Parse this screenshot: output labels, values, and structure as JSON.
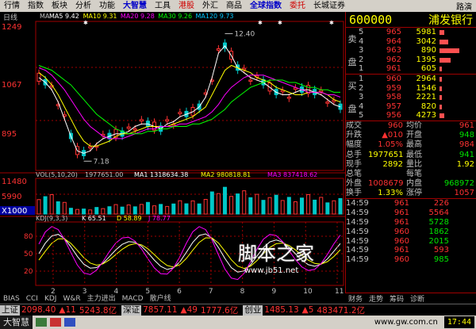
{
  "menu": {
    "items": [
      {
        "label": "行情",
        "style": "normal"
      },
      {
        "label": "指数",
        "style": "normal"
      },
      {
        "label": "板块",
        "style": "normal"
      },
      {
        "label": "分析",
        "style": "normal"
      },
      {
        "label": "功能",
        "style": "normal"
      },
      {
        "label": "大智慧",
        "style": "blue"
      },
      {
        "label": "工具",
        "style": "normal"
      },
      {
        "label": "港股",
        "style": "red"
      },
      {
        "label": "外汇",
        "style": "normal"
      },
      {
        "label": "商品",
        "style": "normal"
      },
      {
        "label": "全球指数",
        "style": "blue"
      },
      {
        "label": "委托",
        "style": "red"
      },
      {
        "label": "长城证券",
        "style": "normal"
      }
    ],
    "right_label": "路演"
  },
  "chart_header": {
    "period": "日线",
    "ma_label": "MA",
    "ma": [
      {
        "label": "MA5",
        "value": "9.42",
        "color": "#ffffff"
      },
      {
        "label": "MA10",
        "value": "9.31",
        "color": "#ffff00"
      },
      {
        "label": "MA20",
        "value": "9.28",
        "color": "#ff00ff"
      },
      {
        "label": "MA30",
        "value": "9.26",
        "color": "#00ff00"
      },
      {
        "label": "MA120",
        "value": "9.73",
        "color": "#00c8ff"
      }
    ]
  },
  "price_axis": [
    "1249",
    "1067",
    "895"
  ],
  "annotations": {
    "high": "12.40",
    "low": "7.18"
  },
  "volume_header": {
    "label": "VOL(5,10,20)",
    "value": "1977651.00",
    "ma1": "MA1 1318634.38",
    "ma2": "MA2 980818.81",
    "ma3": "MA3 837418.62"
  },
  "volume_axis": [
    "11480",
    "5990",
    "X1000"
  ],
  "kdj_header": {
    "label": "KDJ(9,3,3)",
    "k": "K 65.51",
    "d": "D 58.89",
    "j": "J 78.77"
  },
  "kdj_axis": [
    "80",
    "50",
    "20"
  ],
  "month_labels": [
    "2",
    "3",
    "4",
    "5",
    "6",
    "7",
    "8",
    "9",
    "10",
    "11"
  ],
  "indicator_tabs": [
    "BIAS",
    "CCI",
    "KDJ",
    "W&R",
    "主力进出",
    "MACD",
    "散户线"
  ],
  "chart_data": {
    "type": "candlestick",
    "series": [
      {
        "name": "MA5",
        "color": "#ffffff",
        "y": [
          10.6,
          10.4,
          10.1,
          9.6,
          8.9,
          8.2,
          7.6,
          7.5,
          7.6,
          7.9,
          8.1,
          8.2,
          8.3,
          8.3,
          8.4,
          8.6,
          8.7,
          8.7,
          8.6,
          8.5,
          8.7,
          8.8,
          9.0,
          9.1,
          9.2,
          9.4,
          9.8,
          10.6,
          11.6,
          11.9,
          11.5,
          11.0,
          10.8,
          10.6,
          10.5,
          10.4,
          10.2,
          10.0,
          9.9,
          9.9,
          10.0,
          10.1,
          10.1,
          10.0,
          9.9,
          9.7,
          9.5,
          9.4
        ]
      },
      {
        "name": "MA10",
        "color": "#ffff00",
        "y": [
          10.8,
          10.6,
          10.3,
          9.9,
          9.4,
          8.9,
          8.4,
          8.0,
          7.8,
          7.8,
          7.9,
          8.0,
          8.2,
          8.3,
          8.3,
          8.4,
          8.5,
          8.6,
          8.6,
          8.6,
          8.6,
          8.7,
          8.8,
          8.9,
          9.0,
          9.2,
          9.4,
          9.9,
          10.4,
          10.9,
          11.1,
          11.0,
          10.9,
          10.8,
          10.6,
          10.5,
          10.4,
          10.2,
          10.1,
          10.0,
          9.9,
          9.9,
          10.0,
          10.0,
          10.0,
          9.9,
          9.7,
          9.6
        ]
      },
      {
        "name": "MA20",
        "color": "#ff00ff",
        "y": [
          11.0,
          10.9,
          10.7,
          10.4,
          10.1,
          9.7,
          9.3,
          8.9,
          8.6,
          8.4,
          8.2,
          8.1,
          8.1,
          8.1,
          8.2,
          8.3,
          8.4,
          8.5,
          8.5,
          8.6,
          8.6,
          8.6,
          8.7,
          8.7,
          8.8,
          8.9,
          9.0,
          9.2,
          9.5,
          9.9,
          10.2,
          10.4,
          10.6,
          10.7,
          10.7,
          10.7,
          10.6,
          10.5,
          10.4,
          10.3,
          10.2,
          10.1,
          10.0,
          10.0,
          10.0,
          9.9,
          9.9,
          9.8
        ]
      },
      {
        "name": "MA30",
        "color": "#00ff00",
        "y": [
          11.1,
          11.0,
          10.9,
          10.7,
          10.5,
          10.3,
          10.0,
          9.7,
          9.4,
          9.1,
          8.9,
          8.7,
          8.5,
          8.4,
          8.3,
          8.3,
          8.3,
          8.4,
          8.4,
          8.5,
          8.5,
          8.6,
          8.6,
          8.6,
          8.7,
          8.7,
          8.8,
          8.9,
          9.1,
          9.3,
          9.6,
          9.8,
          10.0,
          10.2,
          10.3,
          10.4,
          10.5,
          10.5,
          10.5,
          10.4,
          10.4,
          10.3,
          10.2,
          10.2,
          10.1,
          10.1,
          10.0,
          10.0
        ]
      }
    ],
    "ylim": [
      6.8,
      12.9
    ]
  },
  "stock": {
    "code": "600000",
    "name": "浦发银行"
  },
  "order_book": {
    "sell_label": [
      "卖",
      "盘"
    ],
    "buy_label": [
      "买",
      "盘"
    ],
    "asks": [
      {
        "level": "5",
        "price": "965",
        "vol": "5981",
        "fill": 0.1
      },
      {
        "level": "4",
        "price": "964",
        "vol": "3042",
        "fill": 0.2
      },
      {
        "level": "3",
        "price": "963",
        "vol": "890",
        "fill": 0.45
      },
      {
        "level": "2",
        "price": "962",
        "vol": "1395",
        "fill": 0.25
      },
      {
        "level": "1",
        "price": "961",
        "vol": "605",
        "fill": 0.05
      }
    ],
    "bids": [
      {
        "level": "1",
        "price": "960",
        "vol": "2964",
        "fill": 0.05
      },
      {
        "level": "2",
        "price": "959",
        "vol": "1546",
        "fill": 0.05
      },
      {
        "level": "3",
        "price": "958",
        "vol": "2221",
        "fill": 0.05
      },
      {
        "level": "4",
        "price": "957",
        "vol": "820",
        "fill": 0.05
      },
      {
        "level": "5",
        "price": "956",
        "vol": "4273",
        "fill": 0.1
      }
    ]
  },
  "stats": [
    {
      "l1": "成交",
      "v1": "960",
      "c1": "c-red",
      "l2": "均价",
      "v2": "961",
      "c2": "c-red"
    },
    {
      "l1": "升跌",
      "v1": "▲010",
      "c1": "c-red",
      "l2": "开盘",
      "v2": "948",
      "c2": "c-grn"
    },
    {
      "l1": "幅度",
      "v1": "1.05%",
      "c1": "c-red",
      "l2": "最高",
      "v2": "984",
      "c2": "c-red"
    },
    {
      "l1": "总手",
      "v1": "1977651",
      "c1": "c-yel",
      "l2": "最低",
      "v2": "941",
      "c2": "c-grn"
    },
    {
      "l1": "现手",
      "v1": "2892",
      "c1": "c-yel",
      "l2": "量比",
      "v2": "1.92",
      "c2": "c-yel"
    },
    {
      "l1": "总笔",
      "v1": "",
      "c1": "c-yel",
      "l2": "每笔",
      "v2": "",
      "c2": "c-yel"
    },
    {
      "l1": "外盘",
      "v1": "1008679",
      "c1": "c-red",
      "l2": "内盘",
      "v2": "968972",
      "c2": "c-grn"
    },
    {
      "l1": "换手",
      "v1": "1.33%",
      "c1": "c-yel",
      "l2": "涨停",
      "v2": "1057",
      "c2": "c-red"
    }
  ],
  "ticks": [
    {
      "time": "14:59",
      "price": "961",
      "vol": "226",
      "color": "c-red",
      "dir": ""
    },
    {
      "time": "14:59",
      "price": "961",
      "vol": "5564",
      "color": "c-red",
      "dir": ""
    },
    {
      "time": "14:59",
      "price": "961",
      "vol": "5728",
      "color": "c-grn",
      "dir": ""
    },
    {
      "time": "14:59",
      "price": "960",
      "vol": "1862",
      "color": "c-grn",
      "dir": ""
    },
    {
      "time": "14:59",
      "price": "960",
      "vol": "2015",
      "color": "c-grn",
      "dir": ""
    },
    {
      "time": "14:59",
      "price": "961",
      "vol": "593",
      "color": "c-red",
      "dir": ""
    },
    {
      "time": "14:59",
      "price": "960",
      "vol": "985",
      "color": "c-grn",
      "dir": ""
    }
  ],
  "panel_tabs": [
    "财务",
    "走势",
    "筹码",
    "诊断"
  ],
  "ticker": [
    {
      "name": "上证",
      "value": "2098.40",
      "change": "▲11",
      "amount": "5243.8亿",
      "color": "red"
    },
    {
      "name": "深证",
      "value": "7857.11",
      "change": "▲49",
      "amount": "1777.6亿",
      "color": "red"
    },
    {
      "name": "创业",
      "value": "1485.13",
      "change": "▲5",
      "amount": "483471.2亿",
      "color": "red"
    }
  ],
  "status": {
    "brand": "大智慧",
    "url": "www.gw.com.cn",
    "clock": "17:44"
  },
  "watermark": {
    "text": "脚本之家",
    "sub": "www.jb51.net"
  }
}
